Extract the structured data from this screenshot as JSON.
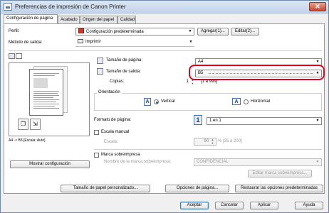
{
  "window": {
    "title": "Preferencias de impresión de Canon Printer",
    "close_label": "✕"
  },
  "tabs": [
    {
      "label": "Configuración de página"
    },
    {
      "label": "Acabado"
    },
    {
      "label": "Origen del papel"
    },
    {
      "label": "Calidad"
    }
  ],
  "profile": {
    "label": "Perfil:",
    "value": "Configuración predeterminada",
    "add_button": "Agregar(1)...",
    "edit_button": "Editar(2)..."
  },
  "output_method": {
    "label": "Método de salida:",
    "value": "Imprimir"
  },
  "page_size": {
    "label": "Tamaño de página:",
    "value": "A4"
  },
  "output_size": {
    "label": "Tamaño de salida:",
    "value": "B5"
  },
  "copies": {
    "label": "Copias:",
    "value": "1",
    "range": "[1 a 999]"
  },
  "orientation": {
    "label": "Orientación",
    "vertical_label": "Vertical",
    "horizontal_label": "Horizontal",
    "icon_letter": "A"
  },
  "page_layout": {
    "label": "Formato de página:",
    "icon_number": "1",
    "value": "1 en 1"
  },
  "manual_scale": {
    "label": "Escala manual",
    "scale_label": "Escala:",
    "scale_value": "90",
    "scale_range": "% [25 a 200]"
  },
  "watermark": {
    "label": "Marca sobreimpresa",
    "name_label": "Nombre de la marca sobreimpresa:",
    "name_value": "CONFIDENCIAL",
    "edit_button": "Editar marca sobreimpresa..."
  },
  "preview": {
    "caption": "A4 -> B5 [Escala: Auto]",
    "show_config_button": "Mostrar configuración"
  },
  "bottom_buttons": {
    "custom_paper": "Tamaño de papel personalizado...",
    "page_options": "Opciones de página...",
    "restore_defaults": "Restaurar las opciones predeterminadas"
  },
  "dialog_buttons": {
    "accept": "Aceptar",
    "cancel": "Cancelar",
    "apply": "Aplicar",
    "help": "Ayuda"
  },
  "colors": {
    "highlight": "#e2001a",
    "accent": "#1b62b5"
  }
}
